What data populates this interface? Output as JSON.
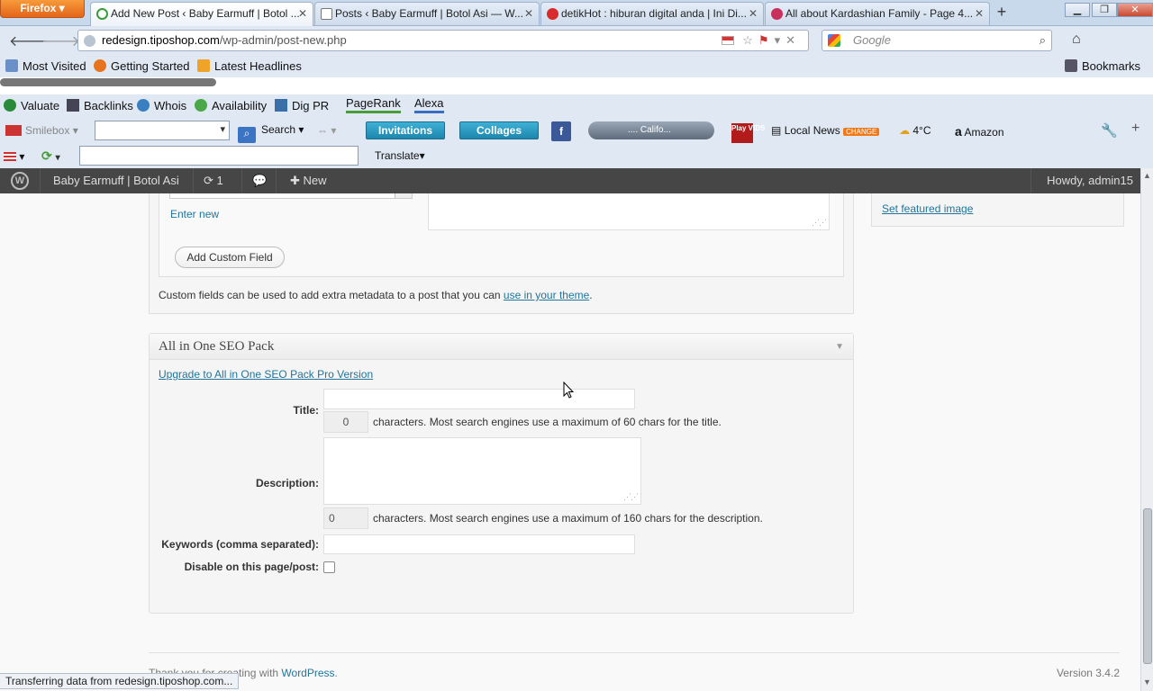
{
  "browser": {
    "menu_button": "Firefox",
    "tabs": [
      {
        "title": "Add New Post ‹ Baby Earmuff | Botol ...",
        "active": true
      },
      {
        "title": "Posts ‹ Baby Earmuff | Botol Asi — W..."
      },
      {
        "title": "detikHot : hiburan digital anda | Ini Di..."
      },
      {
        "title": "All about Kardashian Family - Page 4..."
      }
    ],
    "url_domain": "redesign.tiposhop.com",
    "url_path": "/wp-admin/post-new.php",
    "search_placeholder": "Google"
  },
  "bookmarks": {
    "items": [
      "Most Visited",
      "Getting Started",
      "Latest Headlines"
    ],
    "right": "Bookmarks"
  },
  "toolbar1": {
    "items": [
      "Valuate",
      "Backlinks",
      "Whois",
      "Availability",
      "Dig PR"
    ],
    "pagerank": "PageRank",
    "alexa": "Alexa"
  },
  "toolbar2": {
    "smilebox": "Smilebox",
    "search": "Search",
    "invitations": "Invitations",
    "collages": "Collages",
    "player_text": ".... Califo...",
    "playvids": "Play VIDS",
    "local_news": "Local News",
    "change": "CHANGE",
    "weather": "4°C",
    "amazon": "Amazon"
  },
  "toolbar3": {
    "translate": "Translate"
  },
  "adminbar": {
    "site_name": "Baby Earmuff | Botol Asi",
    "updates_count": "1",
    "new_label": "New",
    "howdy": "Howdy, admin15"
  },
  "custom_fields": {
    "enter_new": "Enter new",
    "add_button": "Add Custom Field",
    "help_text": "Custom fields can be used to add extra metadata to a post that you can ",
    "help_link": "use in your theme",
    "help_end": "."
  },
  "featured_image": {
    "link": "Set featured image"
  },
  "seo": {
    "title": "All in One SEO Pack",
    "upgrade_link": "Upgrade to All in One SEO Pack Pro Version",
    "title_label": "Title:",
    "title_count": "0",
    "title_hint": "characters. Most search engines use a maximum of 60 chars for the title.",
    "desc_label": "Description:",
    "desc_count": "0",
    "desc_hint": "characters. Most search engines use a maximum of 160 chars for the description.",
    "keywords_label": "Keywords (comma separated):",
    "disable_label": "Disable on this page/post:"
  },
  "footer": {
    "thanks": "Thank you for creating with ",
    "wp_link": "WordPress",
    "version": "Version 3.4.2"
  },
  "status": "Transferring data from redesign.tiposhop.com..."
}
